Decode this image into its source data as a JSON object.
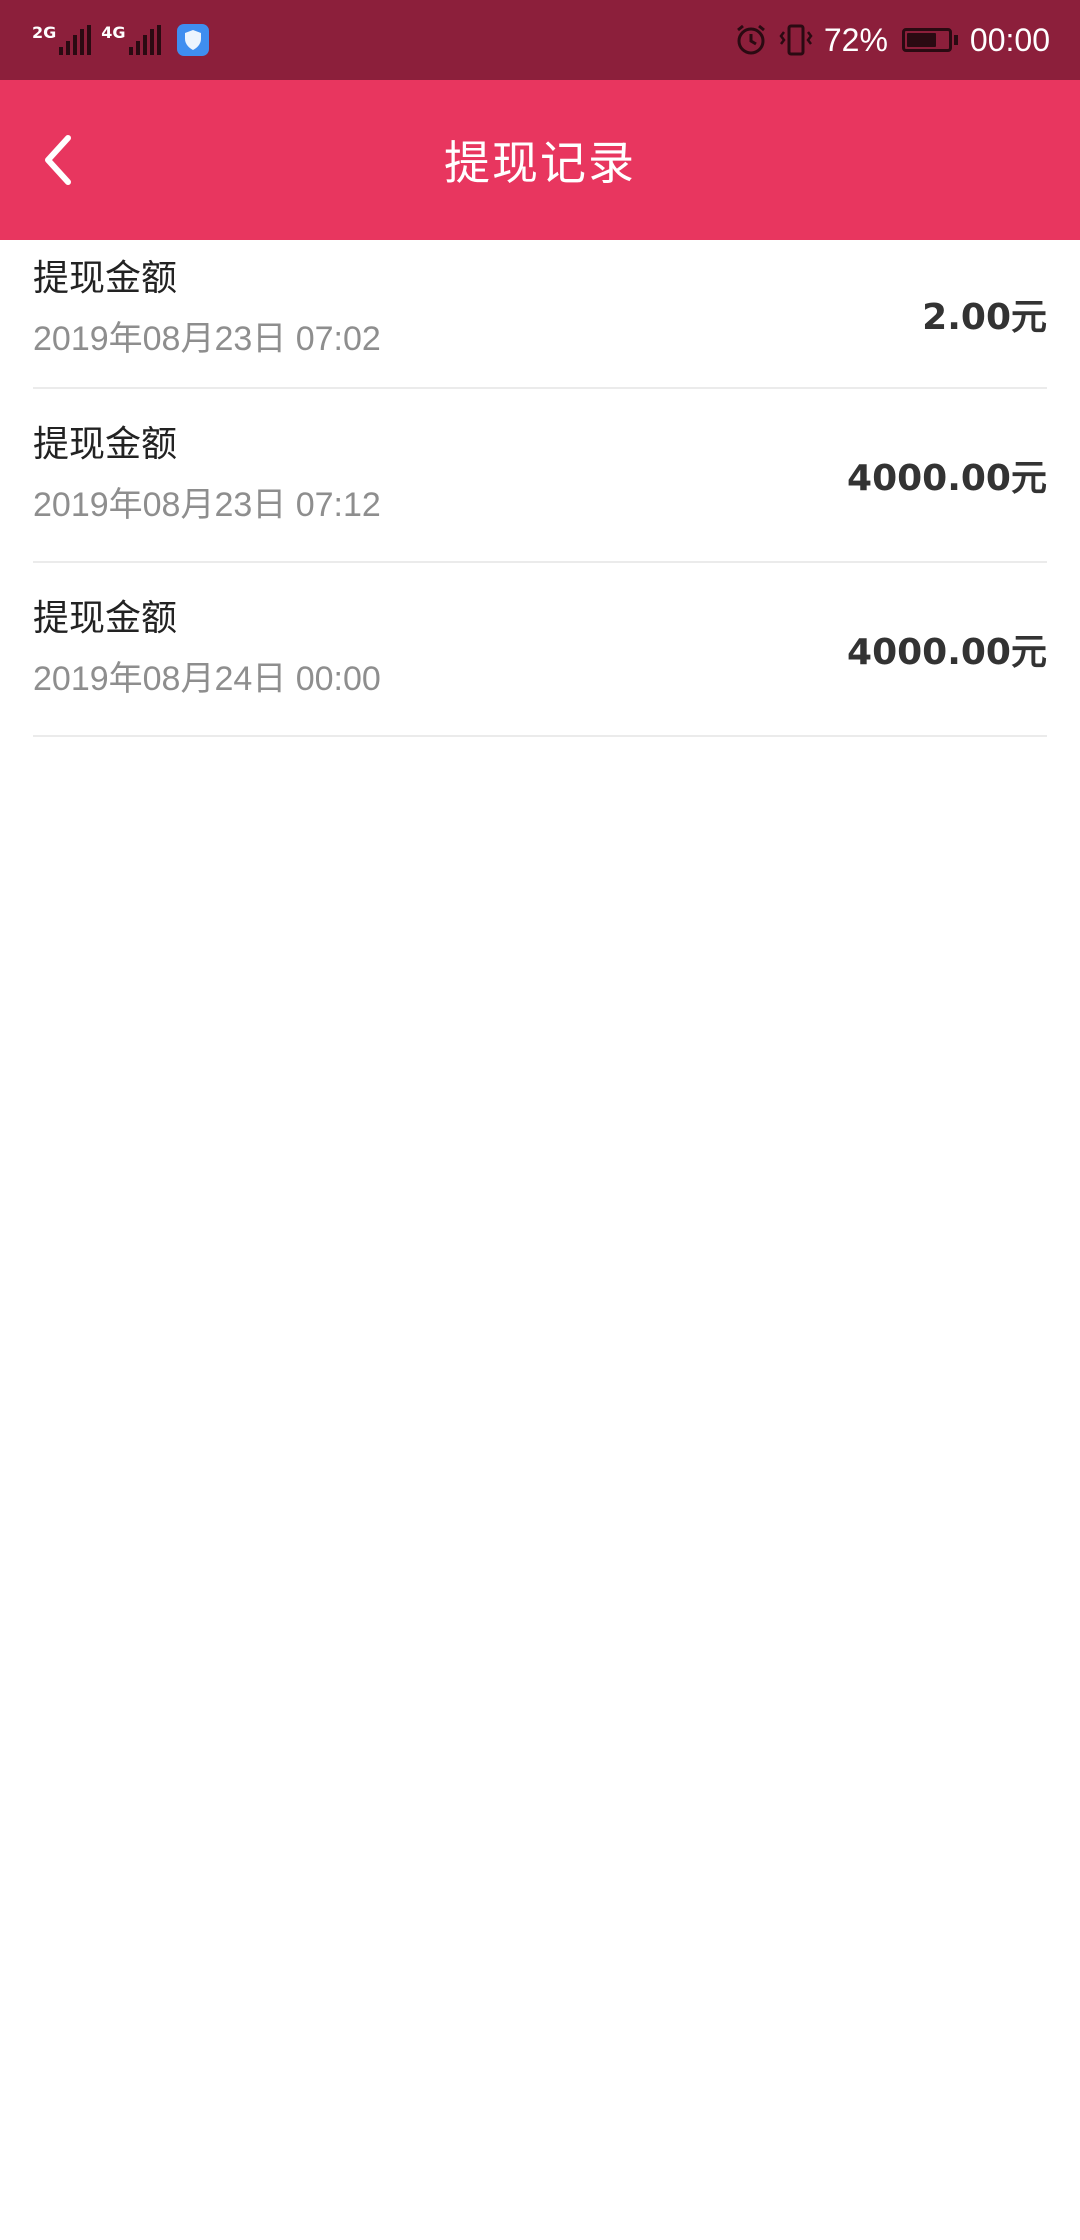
{
  "status_bar": {
    "network1": "2G",
    "network2": "4G",
    "battery_percent": "72%",
    "battery_level": 0.72,
    "time": "00:00",
    "icons": [
      "signal-icon",
      "shield-app-icon",
      "alarm-icon",
      "vibrate-icon",
      "battery-icon"
    ]
  },
  "header": {
    "title": "提现记录",
    "back_icon": "chevron-left-icon",
    "color": "#e8365f"
  },
  "records": [
    {
      "title": "提现金额",
      "date": "2019年08月23日 07:02",
      "amount": "2.00元"
    },
    {
      "title": "提现金额",
      "date": "2019年08月23日 07:12",
      "amount": "4000.00元"
    },
    {
      "title": "提现金额",
      "date": "2019年08月24日 00:00",
      "amount": "4000.00元"
    }
  ]
}
